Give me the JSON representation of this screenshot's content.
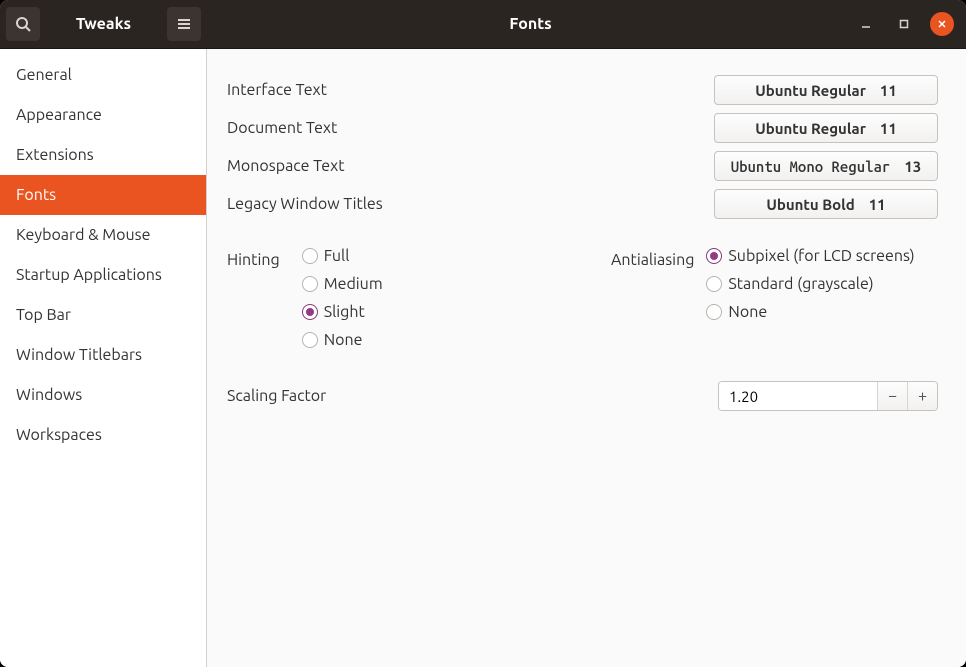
{
  "app": {
    "title": "Tweaks",
    "page_title": "Fonts"
  },
  "sidebar": {
    "items": [
      {
        "label": "General",
        "selected": false
      },
      {
        "label": "Appearance",
        "selected": false
      },
      {
        "label": "Extensions",
        "selected": false
      },
      {
        "label": "Fonts",
        "selected": true
      },
      {
        "label": "Keyboard & Mouse",
        "selected": false
      },
      {
        "label": "Startup Applications",
        "selected": false
      },
      {
        "label": "Top Bar",
        "selected": false
      },
      {
        "label": "Window Titlebars",
        "selected": false
      },
      {
        "label": "Windows",
        "selected": false
      },
      {
        "label": "Workspaces",
        "selected": false
      }
    ]
  },
  "fonts": {
    "rows": [
      {
        "label": "Interface Text",
        "name": "Ubuntu Regular",
        "size": "11",
        "mono": false
      },
      {
        "label": "Document Text",
        "name": "Ubuntu Regular",
        "size": "11",
        "mono": false
      },
      {
        "label": "Monospace Text",
        "name": "Ubuntu Mono Regular",
        "size": "13",
        "mono": true
      },
      {
        "label": "Legacy Window Titles",
        "name": "Ubuntu Bold",
        "size": "11",
        "mono": false
      }
    ]
  },
  "hinting": {
    "label": "Hinting",
    "options": [
      {
        "label": "Full",
        "checked": false
      },
      {
        "label": "Medium",
        "checked": false
      },
      {
        "label": "Slight",
        "checked": true
      },
      {
        "label": "None",
        "checked": false
      }
    ]
  },
  "antialiasing": {
    "label": "Antialiasing",
    "options": [
      {
        "label": "Subpixel (for LCD screens)",
        "checked": true
      },
      {
        "label": "Standard (grayscale)",
        "checked": false
      },
      {
        "label": "None",
        "checked": false
      }
    ]
  },
  "scaling": {
    "label": "Scaling Factor",
    "value": "1.20",
    "minus": "−",
    "plus": "+"
  }
}
